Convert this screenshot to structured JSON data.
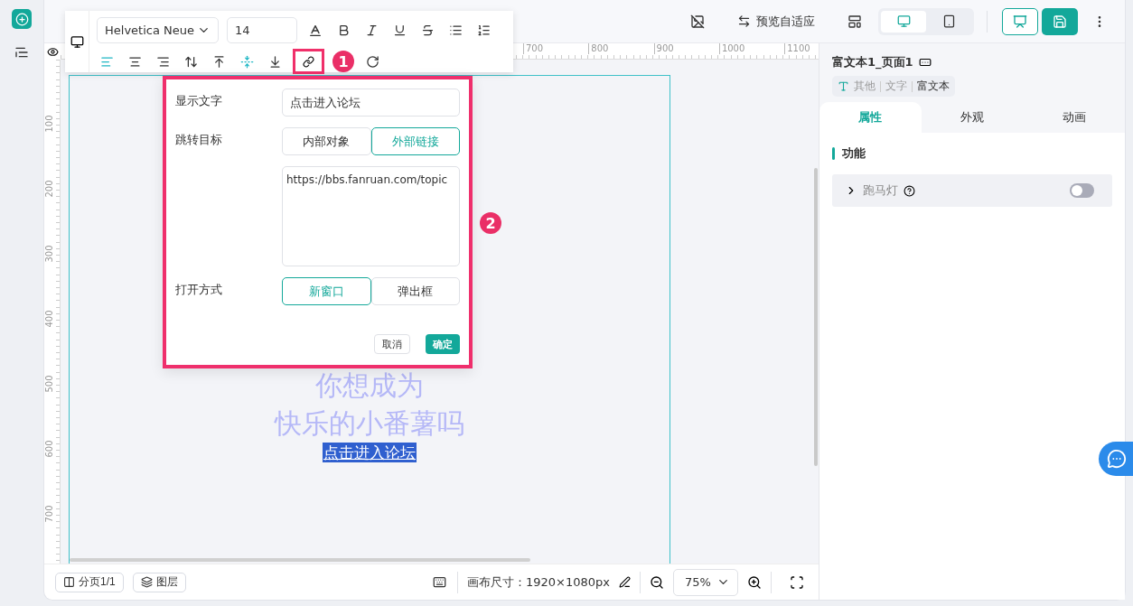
{
  "toolbar": {
    "font": "Helvetica Neue",
    "size": "14",
    "text_align": [
      {
        "kind": "left",
        "selected": true
      },
      {
        "kind": "center",
        "selected": false
      },
      {
        "kind": "right",
        "selected": false
      }
    ],
    "vertical_align": [
      {
        "kind": "top",
        "selected": false
      },
      {
        "kind": "middle",
        "selected": true
      },
      {
        "kind": "bottom",
        "selected": false
      }
    ]
  },
  "top_bar": {
    "preview_label": "预览自适应",
    "devices": [
      {
        "kind": "desktop",
        "selected": true
      },
      {
        "kind": "mobile",
        "selected": false
      }
    ]
  },
  "ruler": {
    "x_labels": [
      "700",
      "800",
      "900",
      "1000",
      "1100"
    ],
    "y_labels": [
      "100",
      "200",
      "300",
      "400",
      "500",
      "600",
      "700"
    ]
  },
  "canvas": {
    "lines": [
      "你想成为",
      "快乐的小番薯吗"
    ],
    "link_text": "点击进入论坛"
  },
  "link_dialog": {
    "display_label": "显示文字",
    "display_value": "点击进入论坛",
    "target_label": "跳转目标",
    "targets": [
      {
        "label": "内部对象",
        "selected": false
      },
      {
        "label": "外部链接",
        "selected": true
      }
    ],
    "url": "https://bbs.fanruan.com/topic",
    "open_label": "打开方式",
    "open_modes": [
      {
        "label": "新窗口",
        "selected": true
      },
      {
        "label": "弹出框",
        "selected": false
      }
    ],
    "cancel": "取消",
    "ok": "确定"
  },
  "callouts": [
    "1",
    "2"
  ],
  "bottom_bar": {
    "pages": "分页1/1",
    "layers": "图层",
    "canvas_size": "画布尺寸：1920×1080px",
    "zoom": "75%"
  },
  "right_panel": {
    "title": "富文本1_页面1",
    "breadcrumb": [
      "其他",
      "文字",
      "富文本"
    ],
    "tabs": [
      {
        "label": "属性",
        "selected": true
      },
      {
        "label": "外观",
        "selected": false
      },
      {
        "label": "动画",
        "selected": false
      }
    ],
    "section": "功能",
    "marquee": {
      "label": "跑马灯",
      "on": false
    }
  }
}
